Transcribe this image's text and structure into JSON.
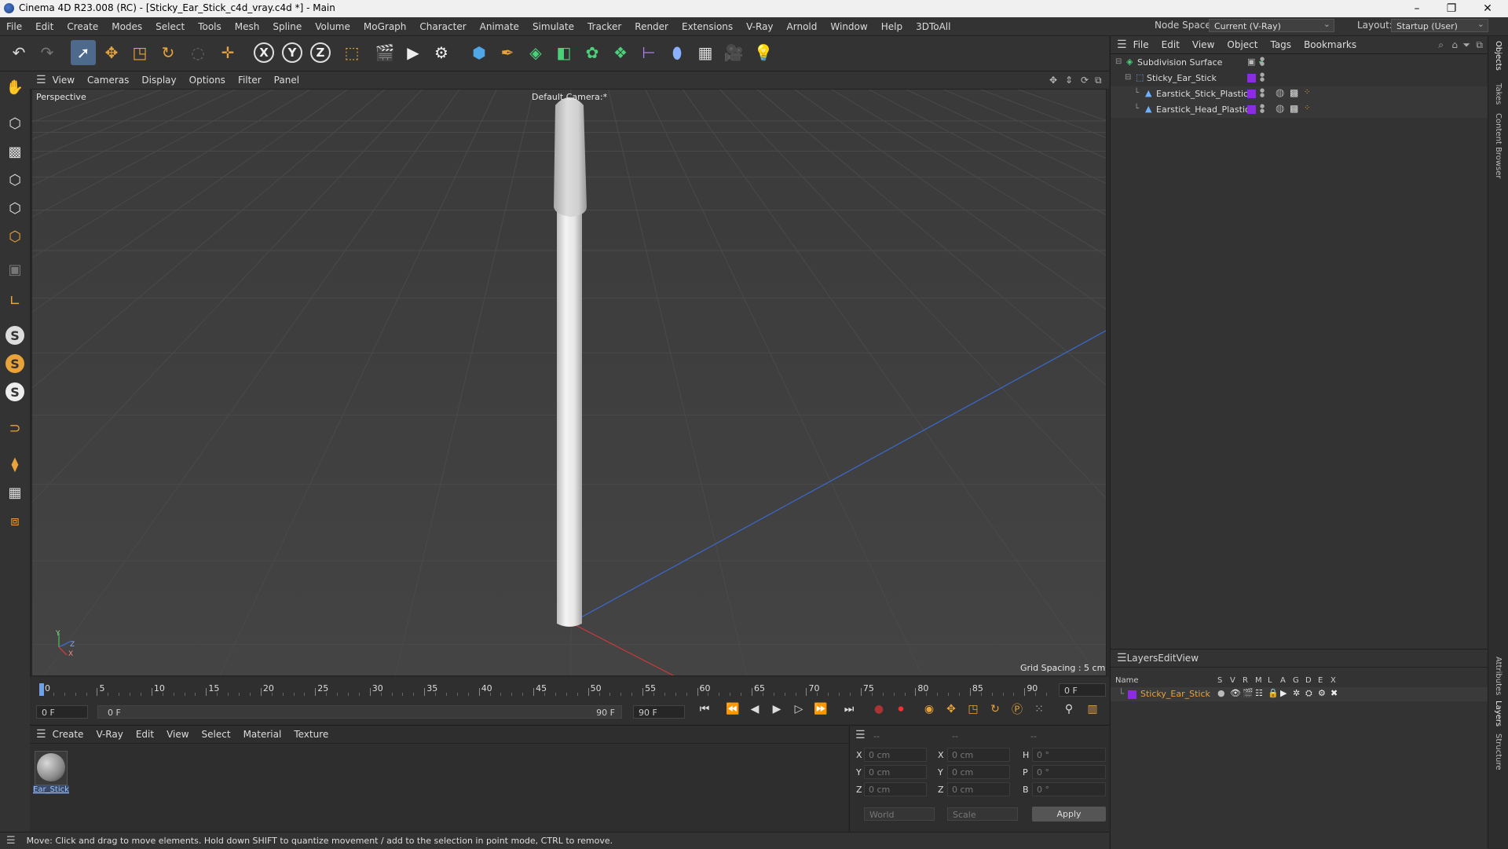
{
  "window": {
    "title": "Cinema 4D R23.008 (RC) - [Sticky_Ear_Stick_c4d_vray.c4d *] - Main",
    "minimize": "–",
    "maximize": "❐",
    "close": "✕"
  },
  "menubar": {
    "items": [
      "File",
      "Edit",
      "Create",
      "Modes",
      "Select",
      "Tools",
      "Mesh",
      "Spline",
      "Volume",
      "MoGraph",
      "Character",
      "Animate",
      "Simulate",
      "Tracker",
      "Render",
      "Extensions",
      "V-Ray",
      "Arnold",
      "Window",
      "Help",
      "3DToAll"
    ],
    "node_space_label": "Node Space:",
    "node_space_value": "Current (V-Ray)",
    "layout_label": "Layout:",
    "layout_value": "Startup (User)"
  },
  "toolbar": {
    "icons": [
      "undo-icon",
      "redo-icon",
      "select-cursor-icon",
      "move-icon",
      "scale-icon",
      "rotate-icon",
      "live-select-icon",
      "transform-icon",
      "x-axis-icon",
      "y-axis-icon",
      "z-axis-icon",
      "coordinate-system-icon",
      "render-region-icon",
      "render-view-icon",
      "render-settings-icon",
      "cube-icon",
      "pen-icon",
      "subdivision-icon",
      "extrude-icon",
      "cloner-icon",
      "boole-icon",
      "deformer-icon",
      "field-icon",
      "floor-icon",
      "camera-icon",
      "light-icon"
    ],
    "glyphs": {
      "x": "X",
      "y": "Y",
      "z": "Z"
    }
  },
  "viewport": {
    "menu": [
      "View",
      "Cameras",
      "Display",
      "Options",
      "Filter",
      "Panel"
    ],
    "label": "Perspective",
    "camera": "Default Camera",
    "camera_suffix": ":*",
    "grid_spacing": "Grid Spacing : 5 cm",
    "axis_y": "Y",
    "axis_z": "Z",
    "axis_x": "X"
  },
  "timeline": {
    "ticks": [
      "0",
      "5",
      "10",
      "15",
      "20",
      "25",
      "30",
      "35",
      "40",
      "45",
      "50",
      "55",
      "60",
      "65",
      "70",
      "75",
      "80",
      "85",
      "90"
    ],
    "current_frame": "0 F",
    "start_field": "0 F",
    "range_start": "0 F",
    "range_end": "90 F",
    "end_field": "90 F"
  },
  "material_panel": {
    "menu": [
      "Create",
      "V-Ray",
      "Edit",
      "View",
      "Select",
      "Material",
      "Texture"
    ],
    "material_name": "Ear_Stick"
  },
  "coords": {
    "headers": [
      "--",
      "--",
      "--"
    ],
    "rows": [
      {
        "l1": "X",
        "v1": "0 cm",
        "l2": "X",
        "v2": "0 cm",
        "l3": "H",
        "v3": "0 °"
      },
      {
        "l1": "Y",
        "v1": "0 cm",
        "l2": "Y",
        "v2": "0 cm",
        "l3": "P",
        "v3": "0 °"
      },
      {
        "l1": "Z",
        "v1": "0 cm",
        "l2": "Z",
        "v2": "0 cm",
        "l3": "B",
        "v3": "0 °"
      }
    ],
    "world": "World",
    "scale": "Scale",
    "apply": "Apply"
  },
  "status": {
    "text": "Move: Click and drag to move elements. Hold down SHIFT to quantize movement / add to the selection in point mode, CTRL to remove."
  },
  "object_manager": {
    "menu": [
      "File",
      "Edit",
      "View",
      "Object",
      "Tags",
      "Bookmarks"
    ],
    "objects": [
      {
        "name": "Subdivision Surface",
        "indent": 0
      },
      {
        "name": "Sticky_Ear_Stick",
        "indent": 1
      },
      {
        "name": "Earstick_Stick_Plastic",
        "indent": 2
      },
      {
        "name": "Earstick_Head_Plastic",
        "indent": 2
      }
    ],
    "swatch_color": "#8b2be2"
  },
  "layers": {
    "menu": [
      "Layers",
      "Edit",
      "View"
    ],
    "col_name": "Name",
    "cols": [
      "S",
      "V",
      "R",
      "M",
      "L",
      "A",
      "G",
      "D",
      "E",
      "X"
    ],
    "layer_name": "Sticky_Ear_Stick"
  },
  "side_tabs": [
    "Objects",
    "Takes",
    "Content Browser",
    "Attributes",
    "Layers",
    "Structure"
  ]
}
